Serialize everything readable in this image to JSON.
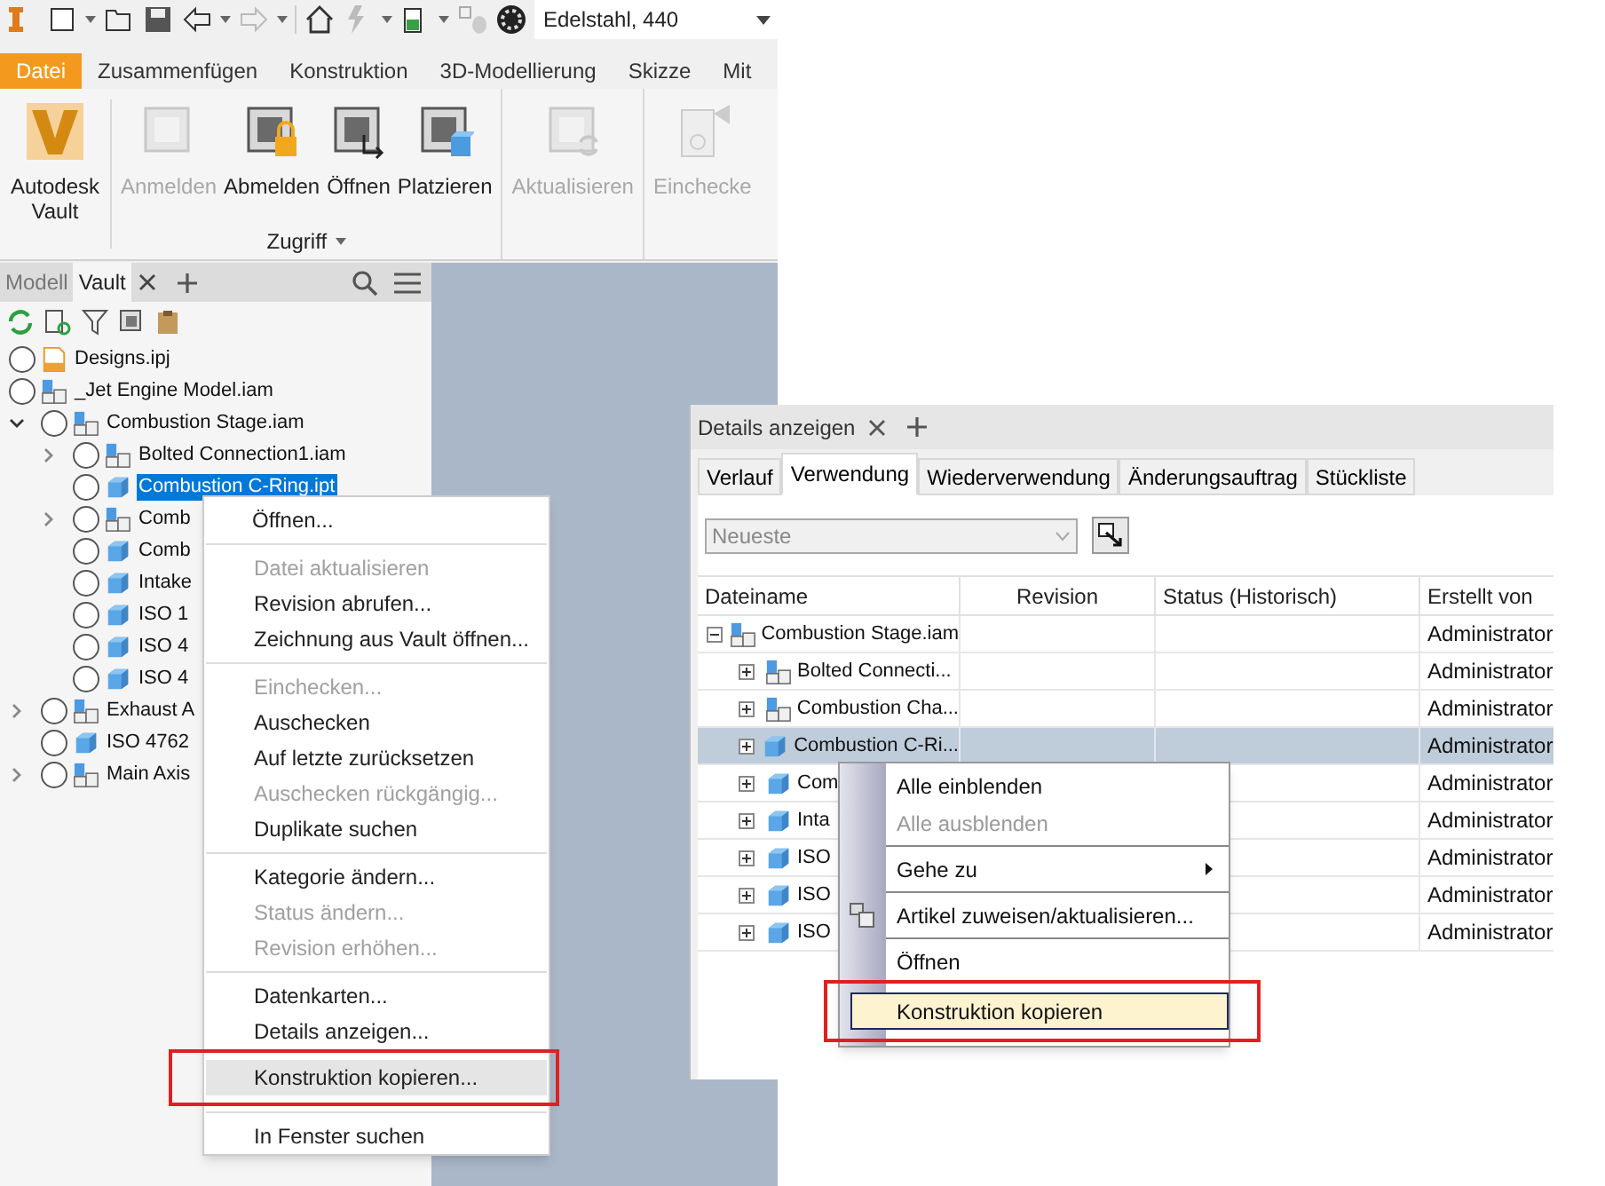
{
  "toolbar": {
    "material": "Edelstahl, 440"
  },
  "ribbon_tabs": [
    {
      "label": "Datei",
      "selected": true
    },
    {
      "label": "Zusammenfügen",
      "selected": false
    },
    {
      "label": "Konstruktion",
      "selected": false
    },
    {
      "label": "3D-Modellierung",
      "selected": false
    },
    {
      "label": "Skizze",
      "selected": false
    },
    {
      "label": "Mit",
      "selected": false
    }
  ],
  "ribbon_buttons": [
    {
      "label": "Autodesk Vault",
      "kind": "vault",
      "disabled": false
    },
    {
      "label": "Anmelden",
      "kind": "login",
      "disabled": true
    },
    {
      "label": "Abmelden",
      "kind": "logout",
      "disabled": false
    },
    {
      "label": "Öffnen",
      "kind": "open",
      "disabled": false
    },
    {
      "label": "Platzieren",
      "kind": "place",
      "disabled": false
    },
    {
      "label": "Aktualisieren",
      "kind": "refresh",
      "disabled": true
    },
    {
      "label": "Einchecke",
      "kind": "checkin",
      "disabled": true
    }
  ],
  "ribbon_group": "Zugriff",
  "browser": {
    "tabs": [
      {
        "label": "Modell",
        "selected": false
      },
      {
        "label": "Vault",
        "selected": true
      }
    ],
    "tree": [
      {
        "label": "Designs.ipj",
        "kind": "project",
        "selected": false
      },
      {
        "label": "_Jet Engine Model.iam",
        "kind": "assembly",
        "selected": false,
        "children": [
          {
            "label": "Combustion Stage.iam",
            "kind": "assembly",
            "expanded": true,
            "selected": false,
            "children": [
              {
                "label": "Bolted Connection1.iam",
                "kind": "assembly",
                "expanded": false,
                "selected": false
              },
              {
                "label": "Combustion C-Ring.ipt",
                "kind": "part",
                "selected": true
              },
              {
                "label": "Comb",
                "kind": "assembly",
                "expanded": false,
                "selected": false
              },
              {
                "label": "Comb",
                "kind": "part",
                "selected": false
              },
              {
                "label": "Intake",
                "kind": "part",
                "selected": false
              },
              {
                "label": "ISO 1",
                "kind": "part",
                "selected": false
              },
              {
                "label": "ISO 4",
                "kind": "part",
                "selected": false
              },
              {
                "label": "ISO 4",
                "kind": "part",
                "selected": false
              }
            ]
          },
          {
            "label": "Exhaust A",
            "kind": "assembly",
            "expanded": false,
            "selected": false
          },
          {
            "label": "ISO 4762",
            "kind": "part",
            "selected": false
          },
          {
            "label": "Main Axis",
            "kind": "assembly",
            "expanded": false,
            "selected": false
          }
        ]
      }
    ]
  },
  "context_menu": {
    "groups": [
      [
        {
          "label": "Öffnen...",
          "disabled": false,
          "selected": false
        }
      ],
      [
        {
          "label": "Datei aktualisieren",
          "disabled": true,
          "selected": false
        },
        {
          "label": "Revision abrufen...",
          "disabled": false,
          "selected": false
        },
        {
          "label": "Zeichnung aus Vault öffnen...",
          "disabled": false,
          "selected": false
        }
      ],
      [
        {
          "label": "Einchecken...",
          "disabled": true,
          "selected": false
        },
        {
          "label": "Auschecken",
          "disabled": false,
          "selected": false
        },
        {
          "label": "Auf letzte zurücksetzen",
          "disabled": false,
          "selected": false
        },
        {
          "label": "Auschecken rückgängig...",
          "disabled": true,
          "selected": false
        },
        {
          "label": "Duplikate suchen",
          "disabled": false,
          "selected": false
        }
      ],
      [
        {
          "label": "Kategorie ändern...",
          "disabled": false,
          "selected": false
        },
        {
          "label": "Status ändern...",
          "disabled": true,
          "selected": false
        },
        {
          "label": "Revision erhöhen...",
          "disabled": true,
          "selected": false
        }
      ],
      [
        {
          "label": "Datenkarten...",
          "disabled": false,
          "selected": false
        },
        {
          "label": "Details anzeigen...",
          "disabled": false,
          "selected": false
        },
        {
          "label": "Konstruktion kopieren...",
          "disabled": false,
          "selected": true
        }
      ],
      [
        {
          "label": "In Fenster suchen",
          "disabled": false,
          "selected": false
        }
      ]
    ]
  },
  "details": {
    "title": "Details anzeigen",
    "tabs": [
      {
        "label": "Verlauf",
        "selected": false
      },
      {
        "label": "Verwendung",
        "selected": true
      },
      {
        "label": "Wiederverwendung",
        "selected": false
      },
      {
        "label": "Änderungsauftrag",
        "selected": false
      },
      {
        "label": "Stückliste",
        "selected": false
      }
    ],
    "version_select": {
      "value": "Neueste"
    },
    "columns": [
      "Dateiname",
      "Revision",
      "Status (Historisch)",
      "Erstellt von"
    ],
    "rows": [
      {
        "name": "Combustion Stage.iam",
        "kind": "assembly",
        "expanded": true,
        "selected": false,
        "created_by": "Administrator",
        "children": [
          {
            "name": "Bolted Connecti...",
            "kind": "assembly",
            "expanded": false,
            "selected": false,
            "created_by": "Administrator"
          },
          {
            "name": "Combustion Cha...",
            "kind": "assembly",
            "expanded": false,
            "selected": false,
            "created_by": "Administrator"
          },
          {
            "name": "Combustion C-Ri...",
            "kind": "part",
            "expanded": false,
            "selected": true,
            "created_by": "Administrator"
          },
          {
            "name": "Com",
            "kind": "part",
            "expanded": false,
            "selected": false,
            "created_by": "Administrator"
          },
          {
            "name": "Inta",
            "kind": "part",
            "expanded": false,
            "selected": false,
            "created_by": "Administrator"
          },
          {
            "name": "ISO",
            "kind": "part",
            "expanded": false,
            "selected": false,
            "created_by": "Administrator"
          },
          {
            "name": "ISO",
            "kind": "part",
            "expanded": false,
            "selected": false,
            "created_by": "Administrator"
          },
          {
            "name": "ISO",
            "kind": "part",
            "expanded": false,
            "selected": false,
            "created_by": "Administrator"
          }
        ]
      }
    ],
    "context_menu": {
      "groups": [
        [
          {
            "label": "Alle einblenden",
            "kind": "plain",
            "disabled": false,
            "selected": false
          },
          {
            "label": "Alle ausblenden",
            "kind": "plain",
            "disabled": true,
            "selected": false
          }
        ],
        [
          {
            "label": "Gehe zu",
            "kind": "submenu",
            "disabled": false,
            "selected": false
          }
        ],
        [
          {
            "label": "Artikel zuweisen/aktualisieren...",
            "kind": "icon",
            "disabled": false,
            "selected": false
          }
        ],
        [
          {
            "label": "Öffnen",
            "kind": "plain",
            "disabled": false,
            "selected": false
          },
          {
            "label": "Konstruktion kopieren",
            "kind": "plain",
            "disabled": false,
            "selected": true
          }
        ]
      ]
    }
  }
}
